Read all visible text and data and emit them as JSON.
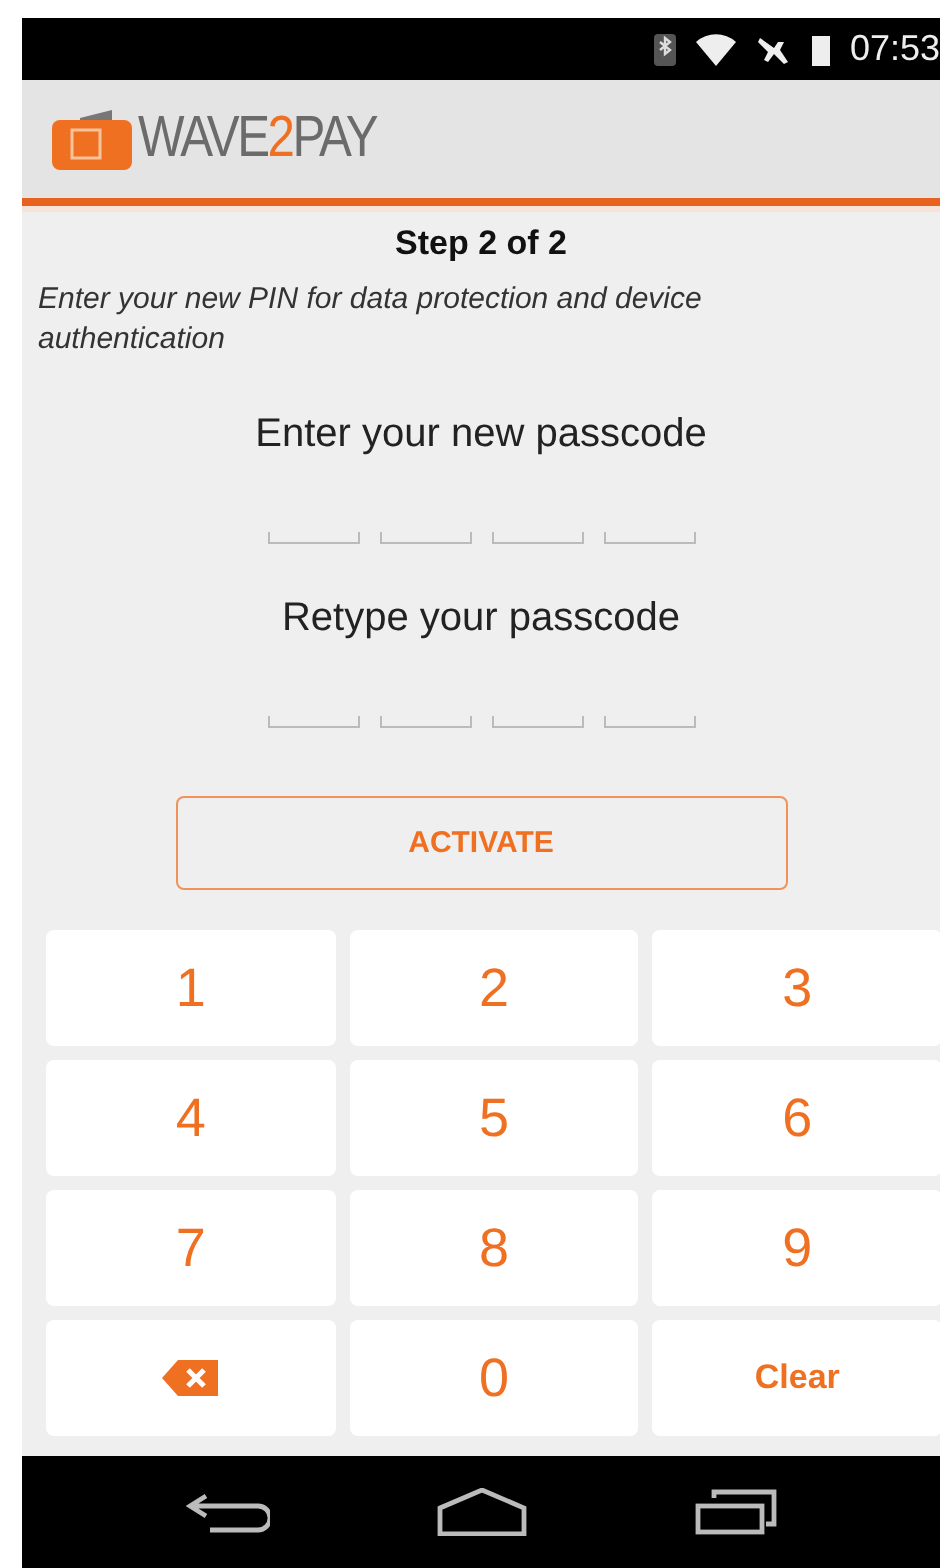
{
  "status_bar": {
    "time": "07:53"
  },
  "app_bar": {
    "logo_parts": [
      {
        "text": "WAVE",
        "accent": false
      },
      {
        "text": "2",
        "accent": true
      },
      {
        "text": "PAY",
        "accent": false
      }
    ]
  },
  "step": "Step 2 of 2",
  "instruction": "Enter your new PIN for data protection and device authentication",
  "passcode_groups": [
    {
      "label": "Enter your new passcode",
      "slots": [
        {
          "filled": false
        },
        {
          "filled": false
        },
        {
          "filled": false
        },
        {
          "filled": false
        }
      ]
    },
    {
      "label": "Retype your passcode",
      "slots": [
        {
          "filled": false
        },
        {
          "filled": false
        },
        {
          "filled": false
        },
        {
          "filled": false
        }
      ]
    }
  ],
  "activate_button": "ACTIVATE",
  "keypad": [
    {
      "kind": "digit",
      "label": "1"
    },
    {
      "kind": "digit",
      "label": "2"
    },
    {
      "kind": "digit",
      "label": "3"
    },
    {
      "kind": "digit",
      "label": "4"
    },
    {
      "kind": "digit",
      "label": "5"
    },
    {
      "kind": "digit",
      "label": "6"
    },
    {
      "kind": "digit",
      "label": "7"
    },
    {
      "kind": "digit",
      "label": "8"
    },
    {
      "kind": "digit",
      "label": "9"
    },
    {
      "kind": "backspace"
    },
    {
      "kind": "digit",
      "label": "0"
    },
    {
      "kind": "clear",
      "label": "Clear"
    }
  ]
}
